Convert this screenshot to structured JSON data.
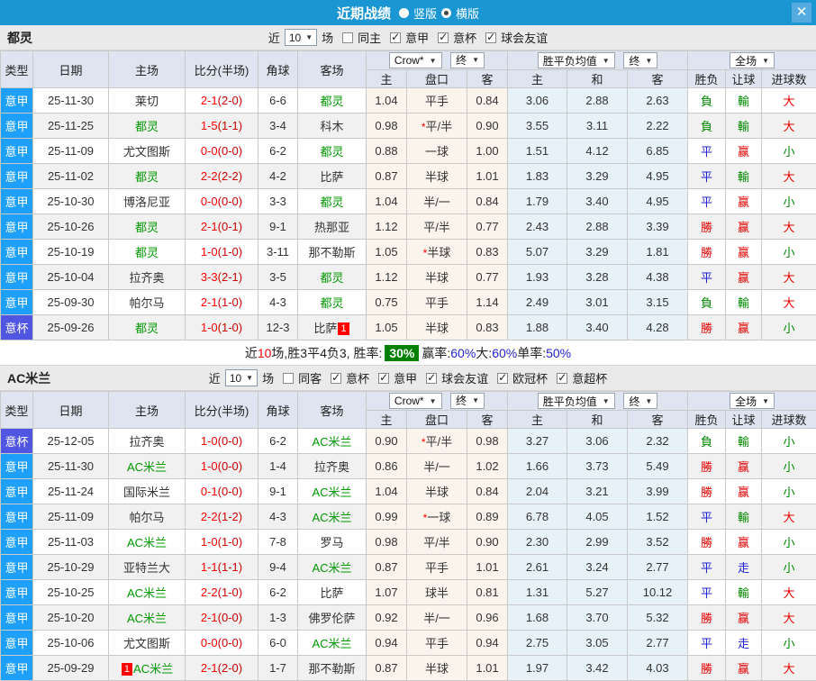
{
  "titlebar": {
    "title": "近期战绩",
    "vertical_label": "竖版",
    "horizontal_label": "横版",
    "horizontal_selected": true,
    "close_glyph": "✕"
  },
  "table_header": {
    "cols": [
      "类型",
      "日期",
      "主场",
      "比分(半场)",
      "角球",
      "客场"
    ],
    "sub": [
      "主",
      "盘口",
      "客",
      "主",
      "和",
      "客",
      "胜负",
      "让球",
      "进球数"
    ],
    "dropdown_bookmaker": "Crow*",
    "dropdown_final_a": "终",
    "dropdown_avg": "胜平负均值",
    "dropdown_final_b": "终",
    "dropdown_scope": "全场"
  },
  "colors": {
    "titlebar": "#1a96d3",
    "close_button": "#55abe0",
    "section_bar": "#eaeaea",
    "header_bg": "#dfe5f0",
    "league_serie_a": "#1e9ffa",
    "league_cup": "#5156e2",
    "handicap_col_bg": "#faf4ec",
    "odds_col_bg": "#e7f2f8",
    "even_row_bg": "#f1f1f1",
    "team_highlight": "#009900",
    "score_red": "#ff0000",
    "result_win_red": "#e60000",
    "result_draw_blue": "#1f1fd6",
    "result_loss_green": "#008800",
    "summary_rate_green": "#008000",
    "summary_value_blue": "#2222cc"
  },
  "sections": [
    {
      "team": "都灵",
      "filter": {
        "prefix": "近",
        "match_count": "10",
        "suffix": "场",
        "options": [
          {
            "label": "同主",
            "checked": false
          },
          {
            "label": "意甲",
            "checked": true
          },
          {
            "label": "意杯",
            "checked": true
          },
          {
            "label": "球会友谊",
            "checked": true
          }
        ]
      },
      "rows": [
        {
          "league": "意甲",
          "date": "25-11-30",
          "home": "莱切",
          "home_green": false,
          "home_badge": "",
          "score": "2-1",
          "half": "(2-0)",
          "corner": "6-6",
          "away": "都灵",
          "away_green": true,
          "away_badge": "",
          "ah_home": "1.04",
          "ah_star": false,
          "ah_line": "平手",
          "ah_away": "0.84",
          "avg_home": "3.06",
          "avg_draw": "2.88",
          "avg_away": "2.63",
          "res_wdl": "負",
          "res_ah": "輸",
          "res_goal": "大"
        },
        {
          "league": "意甲",
          "date": "25-11-25",
          "home": "都灵",
          "home_green": true,
          "home_badge": "",
          "score": "1-5",
          "half": "(1-1)",
          "corner": "3-4",
          "away": "科木",
          "away_green": false,
          "away_badge": "",
          "ah_home": "0.98",
          "ah_star": true,
          "ah_line": "平/半",
          "ah_away": "0.90",
          "avg_home": "3.55",
          "avg_draw": "3.11",
          "avg_away": "2.22",
          "res_wdl": "負",
          "res_ah": "輸",
          "res_goal": "大"
        },
        {
          "league": "意甲",
          "date": "25-11-09",
          "home": "尤文图斯",
          "home_green": false,
          "home_badge": "",
          "score": "0-0",
          "half": "(0-0)",
          "corner": "6-2",
          "away": "都灵",
          "away_green": true,
          "away_badge": "",
          "ah_home": "0.88",
          "ah_star": false,
          "ah_line": "一球",
          "ah_away": "1.00",
          "avg_home": "1.51",
          "avg_draw": "4.12",
          "avg_away": "6.85",
          "res_wdl": "平",
          "res_ah": "赢",
          "res_goal": "小"
        },
        {
          "league": "意甲",
          "date": "25-11-02",
          "home": "都灵",
          "home_green": true,
          "home_badge": "",
          "score": "2-2",
          "half": "(2-2)",
          "corner": "4-2",
          "away": "比萨",
          "away_green": false,
          "away_badge": "",
          "ah_home": "0.87",
          "ah_star": false,
          "ah_line": "半球",
          "ah_away": "1.01",
          "avg_home": "1.83",
          "avg_draw": "3.29",
          "avg_away": "4.95",
          "res_wdl": "平",
          "res_ah": "輸",
          "res_goal": "大"
        },
        {
          "league": "意甲",
          "date": "25-10-30",
          "home": "博洛尼亚",
          "home_green": false,
          "home_badge": "",
          "score": "0-0",
          "half": "(0-0)",
          "corner": "3-3",
          "away": "都灵",
          "away_green": true,
          "away_badge": "",
          "ah_home": "1.04",
          "ah_star": false,
          "ah_line": "半/一",
          "ah_away": "0.84",
          "avg_home": "1.79",
          "avg_draw": "3.40",
          "avg_away": "4.95",
          "res_wdl": "平",
          "res_ah": "赢",
          "res_goal": "小"
        },
        {
          "league": "意甲",
          "date": "25-10-26",
          "home": "都灵",
          "home_green": true,
          "home_badge": "",
          "score": "2-1",
          "half": "(0-1)",
          "corner": "9-1",
          "away": "热那亚",
          "away_green": false,
          "away_badge": "",
          "ah_home": "1.12",
          "ah_star": false,
          "ah_line": "平/半",
          "ah_away": "0.77",
          "avg_home": "2.43",
          "avg_draw": "2.88",
          "avg_away": "3.39",
          "res_wdl": "勝",
          "res_ah": "赢",
          "res_goal": "大"
        },
        {
          "league": "意甲",
          "date": "25-10-19",
          "home": "都灵",
          "home_green": true,
          "home_badge": "",
          "score": "1-0",
          "half": "(1-0)",
          "corner": "3-11",
          "away": "那不勒斯",
          "away_green": false,
          "away_badge": "",
          "ah_home": "1.05",
          "ah_star": true,
          "ah_line": "半球",
          "ah_away": "0.83",
          "avg_home": "5.07",
          "avg_draw": "3.29",
          "avg_away": "1.81",
          "res_wdl": "勝",
          "res_ah": "赢",
          "res_goal": "小"
        },
        {
          "league": "意甲",
          "date": "25-10-04",
          "home": "拉齐奥",
          "home_green": false,
          "home_badge": "",
          "score": "3-3",
          "half": "(2-1)",
          "corner": "3-5",
          "away": "都灵",
          "away_green": true,
          "away_badge": "",
          "ah_home": "1.12",
          "ah_star": false,
          "ah_line": "半球",
          "ah_away": "0.77",
          "avg_home": "1.93",
          "avg_draw": "3.28",
          "avg_away": "4.38",
          "res_wdl": "平",
          "res_ah": "赢",
          "res_goal": "大"
        },
        {
          "league": "意甲",
          "date": "25-09-30",
          "home": "帕尔马",
          "home_green": false,
          "home_badge": "",
          "score": "2-1",
          "half": "(1-0)",
          "corner": "4-3",
          "away": "都灵",
          "away_green": true,
          "away_badge": "",
          "ah_home": "0.75",
          "ah_star": false,
          "ah_line": "平手",
          "ah_away": "1.14",
          "avg_home": "2.49",
          "avg_draw": "3.01",
          "avg_away": "3.15",
          "res_wdl": "負",
          "res_ah": "輸",
          "res_goal": "大"
        },
        {
          "league": "意杯",
          "date": "25-09-26",
          "home": "都灵",
          "home_green": true,
          "home_badge": "",
          "score": "1-0",
          "half": "(1-0)",
          "corner": "12-3",
          "away": "比萨",
          "away_green": false,
          "away_badge": "1",
          "ah_home": "1.05",
          "ah_star": false,
          "ah_line": "半球",
          "ah_away": "0.83",
          "avg_home": "1.88",
          "avg_draw": "3.40",
          "avg_away": "4.28",
          "res_wdl": "勝",
          "res_ah": "赢",
          "res_goal": "小"
        }
      ],
      "summary": [
        {
          "text": "近",
          "style": "plain"
        },
        {
          "text": "10",
          "style": "red"
        },
        {
          "text": "场,胜3平4负3, 胜率: ",
          "style": "plain"
        },
        {
          "text": "30%",
          "style": "greenbox"
        },
        {
          "text": " 赢率:",
          "style": "plain"
        },
        {
          "text": "60%",
          "style": "blue"
        },
        {
          "text": " 大:",
          "style": "plain"
        },
        {
          "text": "60%",
          "style": "blue"
        },
        {
          "text": " 单率:",
          "style": "plain"
        },
        {
          "text": "50%",
          "style": "blue"
        }
      ]
    },
    {
      "team": "AC米兰",
      "filter": {
        "prefix": "近",
        "match_count": "10",
        "suffix": "场",
        "options": [
          {
            "label": "同客",
            "checked": false
          },
          {
            "label": "意杯",
            "checked": true
          },
          {
            "label": "意甲",
            "checked": true
          },
          {
            "label": "球会友谊",
            "checked": true
          },
          {
            "label": "欧冠杯",
            "checked": true
          },
          {
            "label": "意超杯",
            "checked": true
          }
        ]
      },
      "rows": [
        {
          "league": "意杯",
          "date": "25-12-05",
          "home": "拉齐奥",
          "home_green": false,
          "home_badge": "",
          "score": "1-0",
          "half": "(0-0)",
          "corner": "6-2",
          "away": "AC米兰",
          "away_green": true,
          "away_badge": "",
          "ah_home": "0.90",
          "ah_star": true,
          "ah_line": "平/半",
          "ah_away": "0.98",
          "avg_home": "3.27",
          "avg_draw": "3.06",
          "avg_away": "2.32",
          "res_wdl": "負",
          "res_ah": "輸",
          "res_goal": "小"
        },
        {
          "league": "意甲",
          "date": "25-11-30",
          "home": "AC米兰",
          "home_green": true,
          "home_badge": "",
          "score": "1-0",
          "half": "(0-0)",
          "corner": "1-4",
          "away": "拉齐奥",
          "away_green": false,
          "away_badge": "",
          "ah_home": "0.86",
          "ah_star": false,
          "ah_line": "半/一",
          "ah_away": "1.02",
          "avg_home": "1.66",
          "avg_draw": "3.73",
          "avg_away": "5.49",
          "res_wdl": "勝",
          "res_ah": "赢",
          "res_goal": "小"
        },
        {
          "league": "意甲",
          "date": "25-11-24",
          "home": "国际米兰",
          "home_green": false,
          "home_badge": "",
          "score": "0-1",
          "half": "(0-0)",
          "corner": "9-1",
          "away": "AC米兰",
          "away_green": true,
          "away_badge": "",
          "ah_home": "1.04",
          "ah_star": false,
          "ah_line": "半球",
          "ah_away": "0.84",
          "avg_home": "2.04",
          "avg_draw": "3.21",
          "avg_away": "3.99",
          "res_wdl": "勝",
          "res_ah": "赢",
          "res_goal": "小"
        },
        {
          "league": "意甲",
          "date": "25-11-09",
          "home": "帕尔马",
          "home_green": false,
          "home_badge": "",
          "score": "2-2",
          "half": "(1-2)",
          "corner": "4-3",
          "away": "AC米兰",
          "away_green": true,
          "away_badge": "",
          "ah_home": "0.99",
          "ah_star": true,
          "ah_line": "一球",
          "ah_away": "0.89",
          "avg_home": "6.78",
          "avg_draw": "4.05",
          "avg_away": "1.52",
          "res_wdl": "平",
          "res_ah": "輸",
          "res_goal": "大"
        },
        {
          "league": "意甲",
          "date": "25-11-03",
          "home": "AC米兰",
          "home_green": true,
          "home_badge": "",
          "score": "1-0",
          "half": "(1-0)",
          "corner": "7-8",
          "away": "罗马",
          "away_green": false,
          "away_badge": "",
          "ah_home": "0.98",
          "ah_star": false,
          "ah_line": "平/半",
          "ah_away": "0.90",
          "avg_home": "2.30",
          "avg_draw": "2.99",
          "avg_away": "3.52",
          "res_wdl": "勝",
          "res_ah": "赢",
          "res_goal": "小"
        },
        {
          "league": "意甲",
          "date": "25-10-29",
          "home": "亚特兰大",
          "home_green": false,
          "home_badge": "",
          "score": "1-1",
          "half": "(1-1)",
          "corner": "9-4",
          "away": "AC米兰",
          "away_green": true,
          "away_badge": "",
          "ah_home": "0.87",
          "ah_star": false,
          "ah_line": "平手",
          "ah_away": "1.01",
          "avg_home": "2.61",
          "avg_draw": "3.24",
          "avg_away": "2.77",
          "res_wdl": "平",
          "res_ah": "走",
          "res_goal": "小"
        },
        {
          "league": "意甲",
          "date": "25-10-25",
          "home": "AC米兰",
          "home_green": true,
          "home_badge": "",
          "score": "2-2",
          "half": "(1-0)",
          "corner": "6-2",
          "away": "比萨",
          "away_green": false,
          "away_badge": "",
          "ah_home": "1.07",
          "ah_star": false,
          "ah_line": "球半",
          "ah_away": "0.81",
          "avg_home": "1.31",
          "avg_draw": "5.27",
          "avg_away": "10.12",
          "res_wdl": "平",
          "res_ah": "輸",
          "res_goal": "大"
        },
        {
          "league": "意甲",
          "date": "25-10-20",
          "home": "AC米兰",
          "home_green": true,
          "home_badge": "",
          "score": "2-1",
          "half": "(0-0)",
          "corner": "1-3",
          "away": "佛罗伦萨",
          "away_green": false,
          "away_badge": "",
          "ah_home": "0.92",
          "ah_star": false,
          "ah_line": "半/一",
          "ah_away": "0.96",
          "avg_home": "1.68",
          "avg_draw": "3.70",
          "avg_away": "5.32",
          "res_wdl": "勝",
          "res_ah": "赢",
          "res_goal": "大"
        },
        {
          "league": "意甲",
          "date": "25-10-06",
          "home": "尤文图斯",
          "home_green": false,
          "home_badge": "",
          "score": "0-0",
          "half": "(0-0)",
          "corner": "6-0",
          "away": "AC米兰",
          "away_green": true,
          "away_badge": "",
          "ah_home": "0.94",
          "ah_star": false,
          "ah_line": "平手",
          "ah_away": "0.94",
          "avg_home": "2.75",
          "avg_draw": "3.05",
          "avg_away": "2.77",
          "res_wdl": "平",
          "res_ah": "走",
          "res_goal": "小"
        },
        {
          "league": "意甲",
          "date": "25-09-29",
          "home": "AC米兰",
          "home_green": true,
          "home_badge": "1",
          "score": "2-1",
          "half": "(2-0)",
          "corner": "1-7",
          "away": "那不勒斯",
          "away_green": false,
          "away_badge": "",
          "ah_home": "0.87",
          "ah_star": false,
          "ah_line": "半球",
          "ah_away": "1.01",
          "avg_home": "1.97",
          "avg_draw": "3.42",
          "avg_away": "4.03",
          "res_wdl": "勝",
          "res_ah": "赢",
          "res_goal": "大"
        }
      ],
      "summary": null
    }
  ]
}
